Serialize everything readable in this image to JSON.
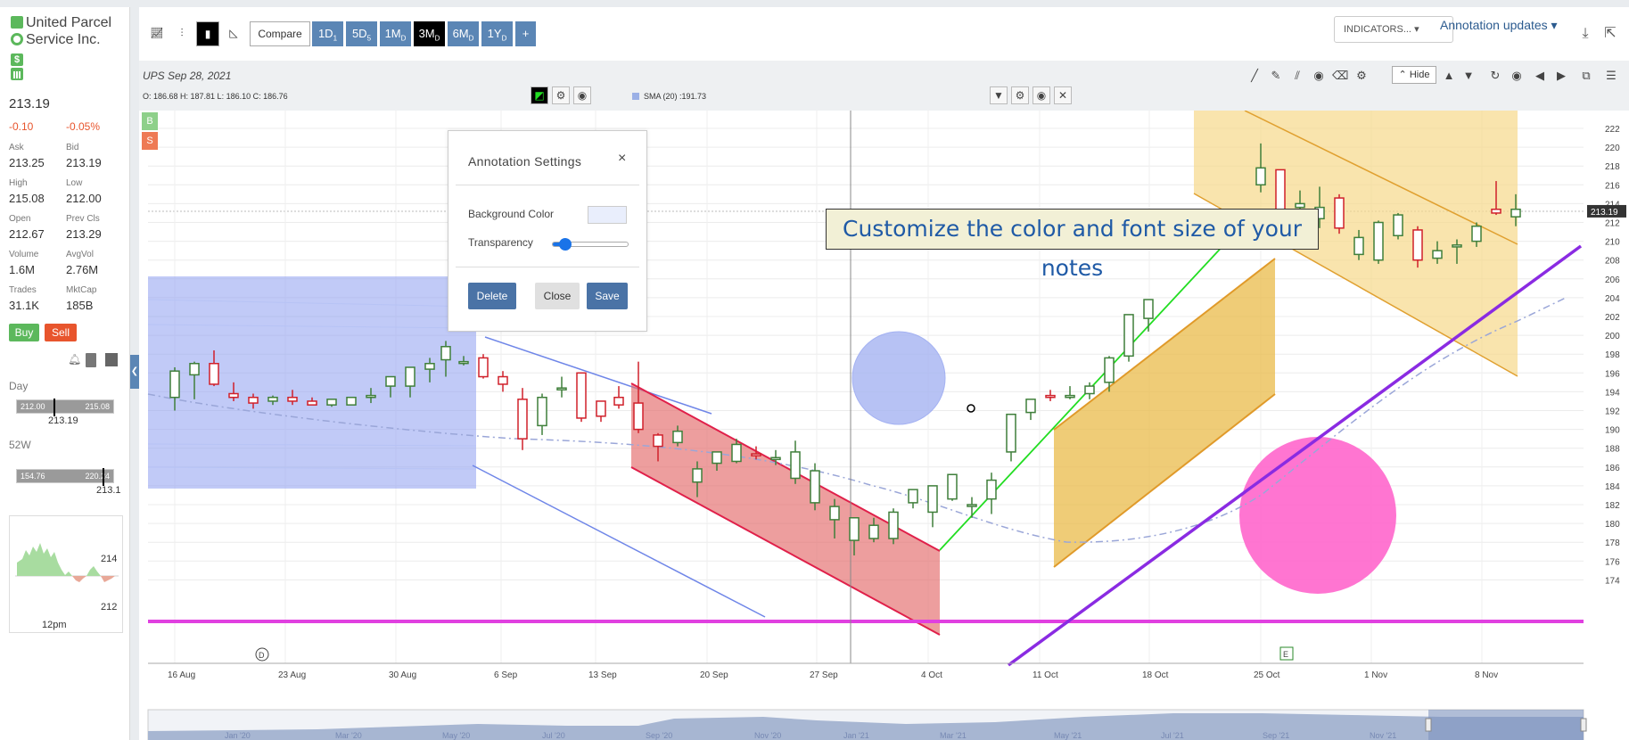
{
  "sidebar": {
    "company_line1": "United Parcel",
    "company_line2": "Service Inc.",
    "last_price": "213.19",
    "change": "-0.10",
    "change_pct": "-0.05%",
    "stats": [
      {
        "label": "Ask",
        "value": "213.25"
      },
      {
        "label": "Bid",
        "value": "213.19"
      },
      {
        "label": "High",
        "value": "215.08"
      },
      {
        "label": "Low",
        "value": "212.00"
      },
      {
        "label": "Open",
        "value": "212.67"
      },
      {
        "label": "Prev Cls",
        "value": "213.29"
      },
      {
        "label": "Volume",
        "value": "1.6M"
      },
      {
        "label": "AvgVol",
        "value": "2.76M"
      },
      {
        "label": "Trades",
        "value": "31.1K"
      },
      {
        "label": "MktCap",
        "value": "185B"
      }
    ],
    "buy_label": "Buy",
    "sell_label": "Sell",
    "day": {
      "label": "Day",
      "low": "212.00",
      "high": "215.08",
      "current": "213.19",
      "position": 0.38
    },
    "w52": {
      "label": "52W",
      "low": "154.76",
      "high": "220.24",
      "current": "213.1",
      "position": 0.89
    },
    "sparkline": {
      "high_label": "214",
      "low_label": "212",
      "time_label": "12pm"
    }
  },
  "toolbar": {
    "compare_label": "Compare",
    "timeframes": [
      {
        "label": "1D",
        "sub": "1",
        "active": false
      },
      {
        "label": "5D",
        "sub": "5",
        "active": false
      },
      {
        "label": "1M",
        "sub": "D",
        "active": false
      },
      {
        "label": "3M",
        "sub": "D",
        "active": true
      },
      {
        "label": "6M",
        "sub": "D",
        "active": false
      },
      {
        "label": "1Y",
        "sub": "D",
        "active": false
      }
    ],
    "add_label": "+",
    "indicators_label": "INDICATORS...",
    "annotation_updates_label": "Annotation updates"
  },
  "chart_header": {
    "symbol_date": "UPS  Sep 28, 2021",
    "ohlc": "O: 186.68  H: 187.81  L: 186.10  C: 186.76",
    "sma": "SMA (20) :191.73",
    "hide_label": "Hide"
  },
  "chart": {
    "buy_marker": "B",
    "sell_marker": "S",
    "price_axis": [
      "222",
      "220",
      "218",
      "216",
      "214",
      "212",
      "210",
      "208",
      "206",
      "204",
      "202",
      "200",
      "198",
      "196",
      "194",
      "192",
      "190",
      "188",
      "186",
      "184",
      "182",
      "180",
      "178",
      "176",
      "174"
    ],
    "current_price_tag": "213.19",
    "date_axis": [
      "16 Aug",
      "23 Aug",
      "30 Aug",
      "6 Sep",
      "13 Sep",
      "20 Sep",
      "27 Sep",
      "4 Oct",
      "11 Oct",
      "18 Oct",
      "25 Oct",
      "1 Nov",
      "8 Nov"
    ],
    "nav_axis": [
      "Jan '20",
      "Mar '20",
      "May '20",
      "Jul '20",
      "Sep '20",
      "Nov '20",
      "Jan '21",
      "Mar '21",
      "May '21",
      "Jul '21",
      "Sep '21",
      "Nov '21"
    ],
    "event_d": "D",
    "event_e": "E",
    "colors": {
      "up": "#3f7f3a",
      "down": "#d0202a",
      "grid": "#e8e8e8",
      "horizontal_line": "#e040e0",
      "trend_line": "#8a2be2"
    }
  },
  "note": {
    "text": "Customize the color and font size of your notes"
  },
  "dialog": {
    "title": "Annotation Settings",
    "close_glyph": "×",
    "background_color_label": "Background Color",
    "transparency_label": "Transparency",
    "transparency_value": 0.1,
    "delete_label": "Delete",
    "close_label": "Close",
    "save_label": "Save"
  }
}
